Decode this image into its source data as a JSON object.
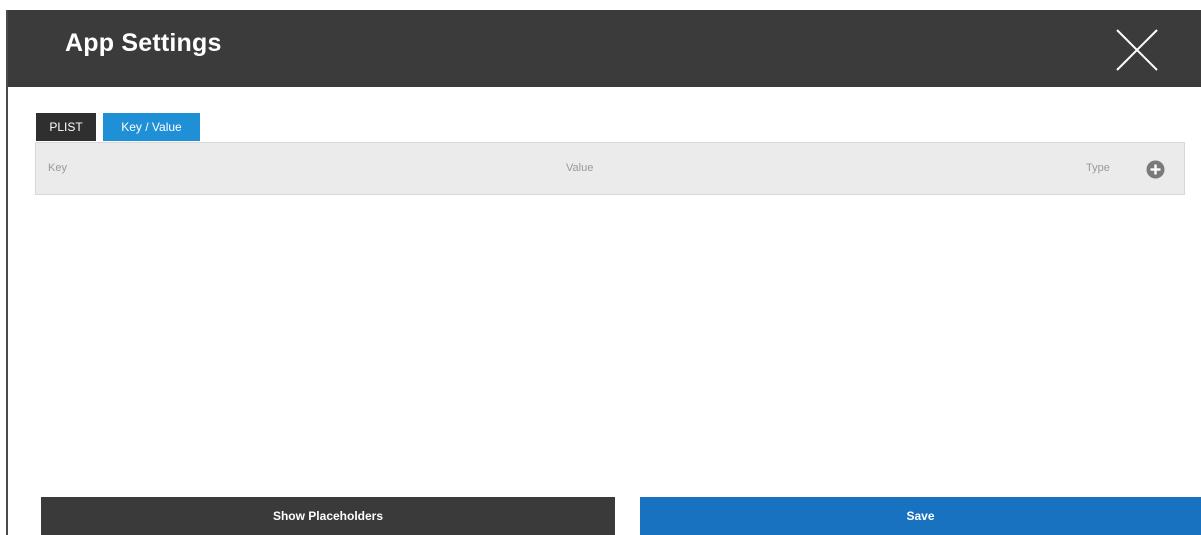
{
  "dialog": {
    "title": "App Settings",
    "close_icon": "close-icon"
  },
  "tabs": [
    {
      "label": "PLIST",
      "active": false
    },
    {
      "label": "Key / Value",
      "active": true
    }
  ],
  "table": {
    "columns": [
      "Key",
      "Value",
      "Type"
    ],
    "add_icon": "plus-circle-icon",
    "rows": []
  },
  "footer": {
    "show_placeholders_label": "Show Placeholders",
    "save_label": "Save"
  },
  "colors": {
    "header_bg": "#3b3b3b",
    "tab_active": "#1f8fd6",
    "tab_inactive": "#2f2f2f",
    "save_button": "#1872bf",
    "placeholders_button": "#3a3a3a",
    "table_header_bg": "#ebebeb"
  }
}
